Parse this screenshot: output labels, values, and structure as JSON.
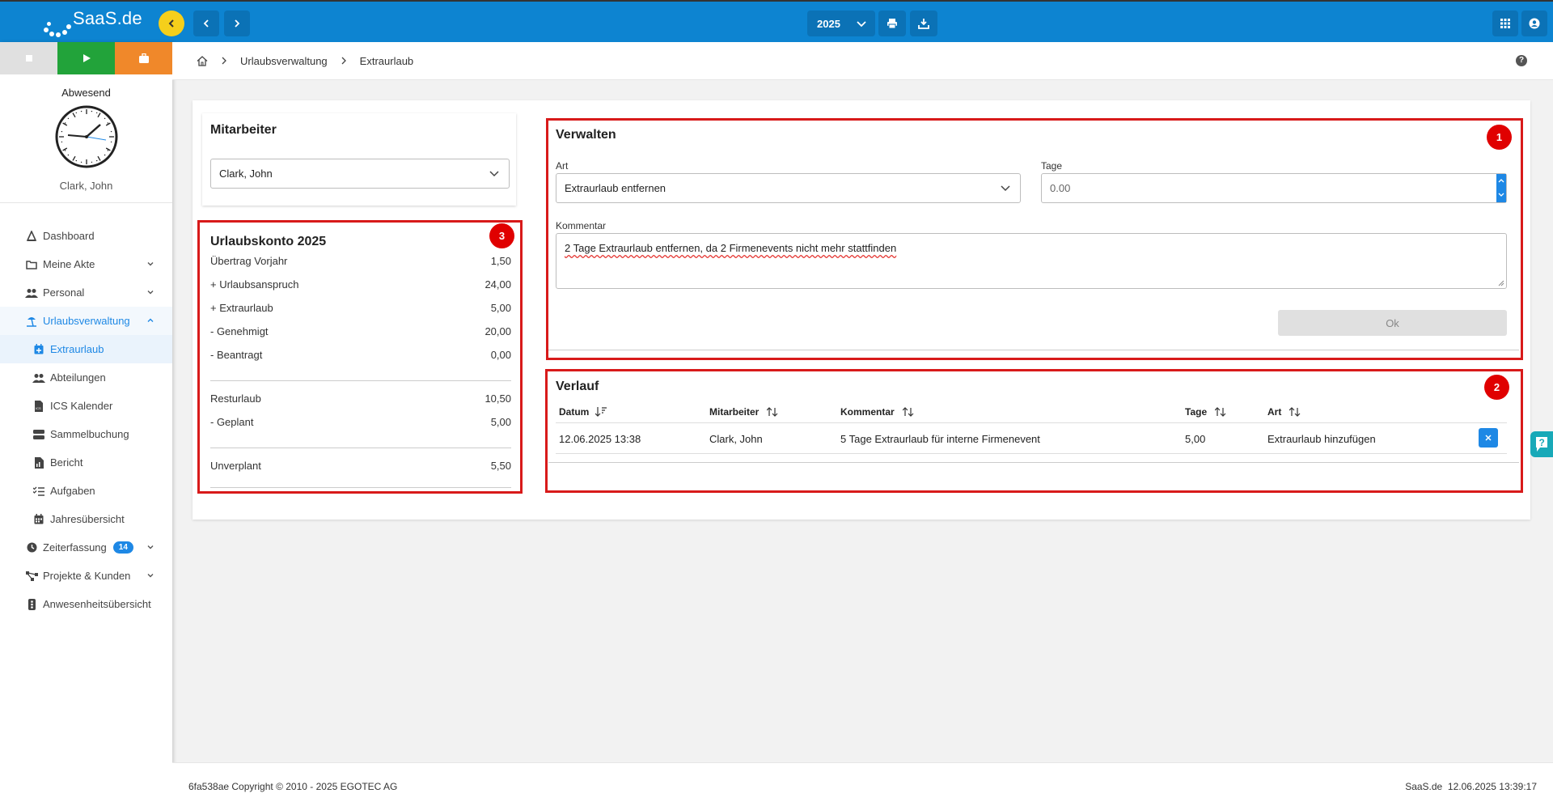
{
  "app": {
    "logo_text": "SaaS.de",
    "year": "2025"
  },
  "topbar": {
    "icons": [
      "chevron-left-icon",
      "arrow-left-icon",
      "arrow-right-icon",
      "printer-icon",
      "download-icon",
      "apps-grid-icon",
      "user-account-icon"
    ],
    "color": "#0d84d1",
    "accent": "#f5cf1b"
  },
  "sidebar": {
    "status_colors": {
      "stop": "#e0e0e0",
      "start": "#22a33a",
      "pause": "#f0882a"
    },
    "status_label": "Abwesend",
    "user_name": "Clark, John",
    "menu": [
      {
        "label": "Dashboard",
        "icon": "dashboard-icon"
      },
      {
        "label": "Meine Akte",
        "icon": "folder-icon"
      },
      {
        "label": "Personal",
        "icon": "people-icon"
      },
      {
        "label": "Urlaubsverwaltung",
        "icon": "beach-icon"
      },
      {
        "label": "Extraurlaub",
        "icon": "calendar-plus-icon"
      },
      {
        "label": "Abteilungen",
        "icon": "group-icon"
      },
      {
        "label": "ICS Kalender",
        "icon": "ics-file-icon"
      },
      {
        "label": "Sammelbuchung",
        "icon": "stack-icon"
      },
      {
        "label": "Bericht",
        "icon": "report-icon"
      },
      {
        "label": "Aufgaben",
        "icon": "checklist-icon"
      },
      {
        "label": "Jahresübersicht",
        "icon": "calendar-icon"
      },
      {
        "label": "Zeiterfassung",
        "icon": "clock-icon",
        "badge": "14"
      },
      {
        "label": "Projekte & Kunden",
        "icon": "network-icon"
      },
      {
        "label": "Anwesenheitsübersicht",
        "icon": "attendance-icon"
      }
    ]
  },
  "breadcrumb": {
    "items": [
      "Urlaubsverwaltung",
      "Extraurlaub"
    ]
  },
  "mitarbeiter": {
    "title": "Mitarbeiter",
    "selected": "Clark, John"
  },
  "konto": {
    "title": "Urlaubskonto 2025",
    "badge": "3",
    "rows": [
      {
        "label": "Übertrag Vorjahr",
        "value": "1,50"
      },
      {
        "label": "+ Urlaubsanspruch",
        "value": "24,00"
      },
      {
        "label": "+ Extraurlaub",
        "value": "5,00"
      },
      {
        "label": "- Genehmigt",
        "value": "20,00"
      },
      {
        "label": "- Beantragt",
        "value": "0,00"
      },
      {
        "label": "Resturlaub",
        "value": "10,50"
      },
      {
        "label": "- Geplant",
        "value": "5,00"
      },
      {
        "label": "Unverplant",
        "value": "5,50"
      }
    ]
  },
  "verwalten": {
    "title": "Verwalten",
    "badge": "1",
    "art_label": "Art",
    "art_value": "Extraurlaub entfernen",
    "tage_label": "Tage",
    "tage_value": "0.00",
    "kommentar_label": "Kommentar",
    "kommentar_value": "2 Tage Extraurlaub entfernen, da 2 Firmenevents nicht mehr stattfinden",
    "ok_label": "Ok"
  },
  "verlauf": {
    "title": "Verlauf",
    "badge": "2",
    "columns": [
      "Datum",
      "Mitarbeiter",
      "Kommentar",
      "Tage",
      "Art"
    ],
    "rows": [
      {
        "datum": "12.06.2025 13:38",
        "mitarbeiter": "Clark, John",
        "kommentar": "5 Tage Extraurlaub für interne Firmenevent",
        "tage": "5,00",
        "art": "Extraurlaub hinzufügen"
      }
    ]
  },
  "footer": {
    "left": "6fa538ae Copyright © 2010 - 2025 EGOTEC AG",
    "right": "SaaS.de  12.06.2025 13:39:17"
  }
}
